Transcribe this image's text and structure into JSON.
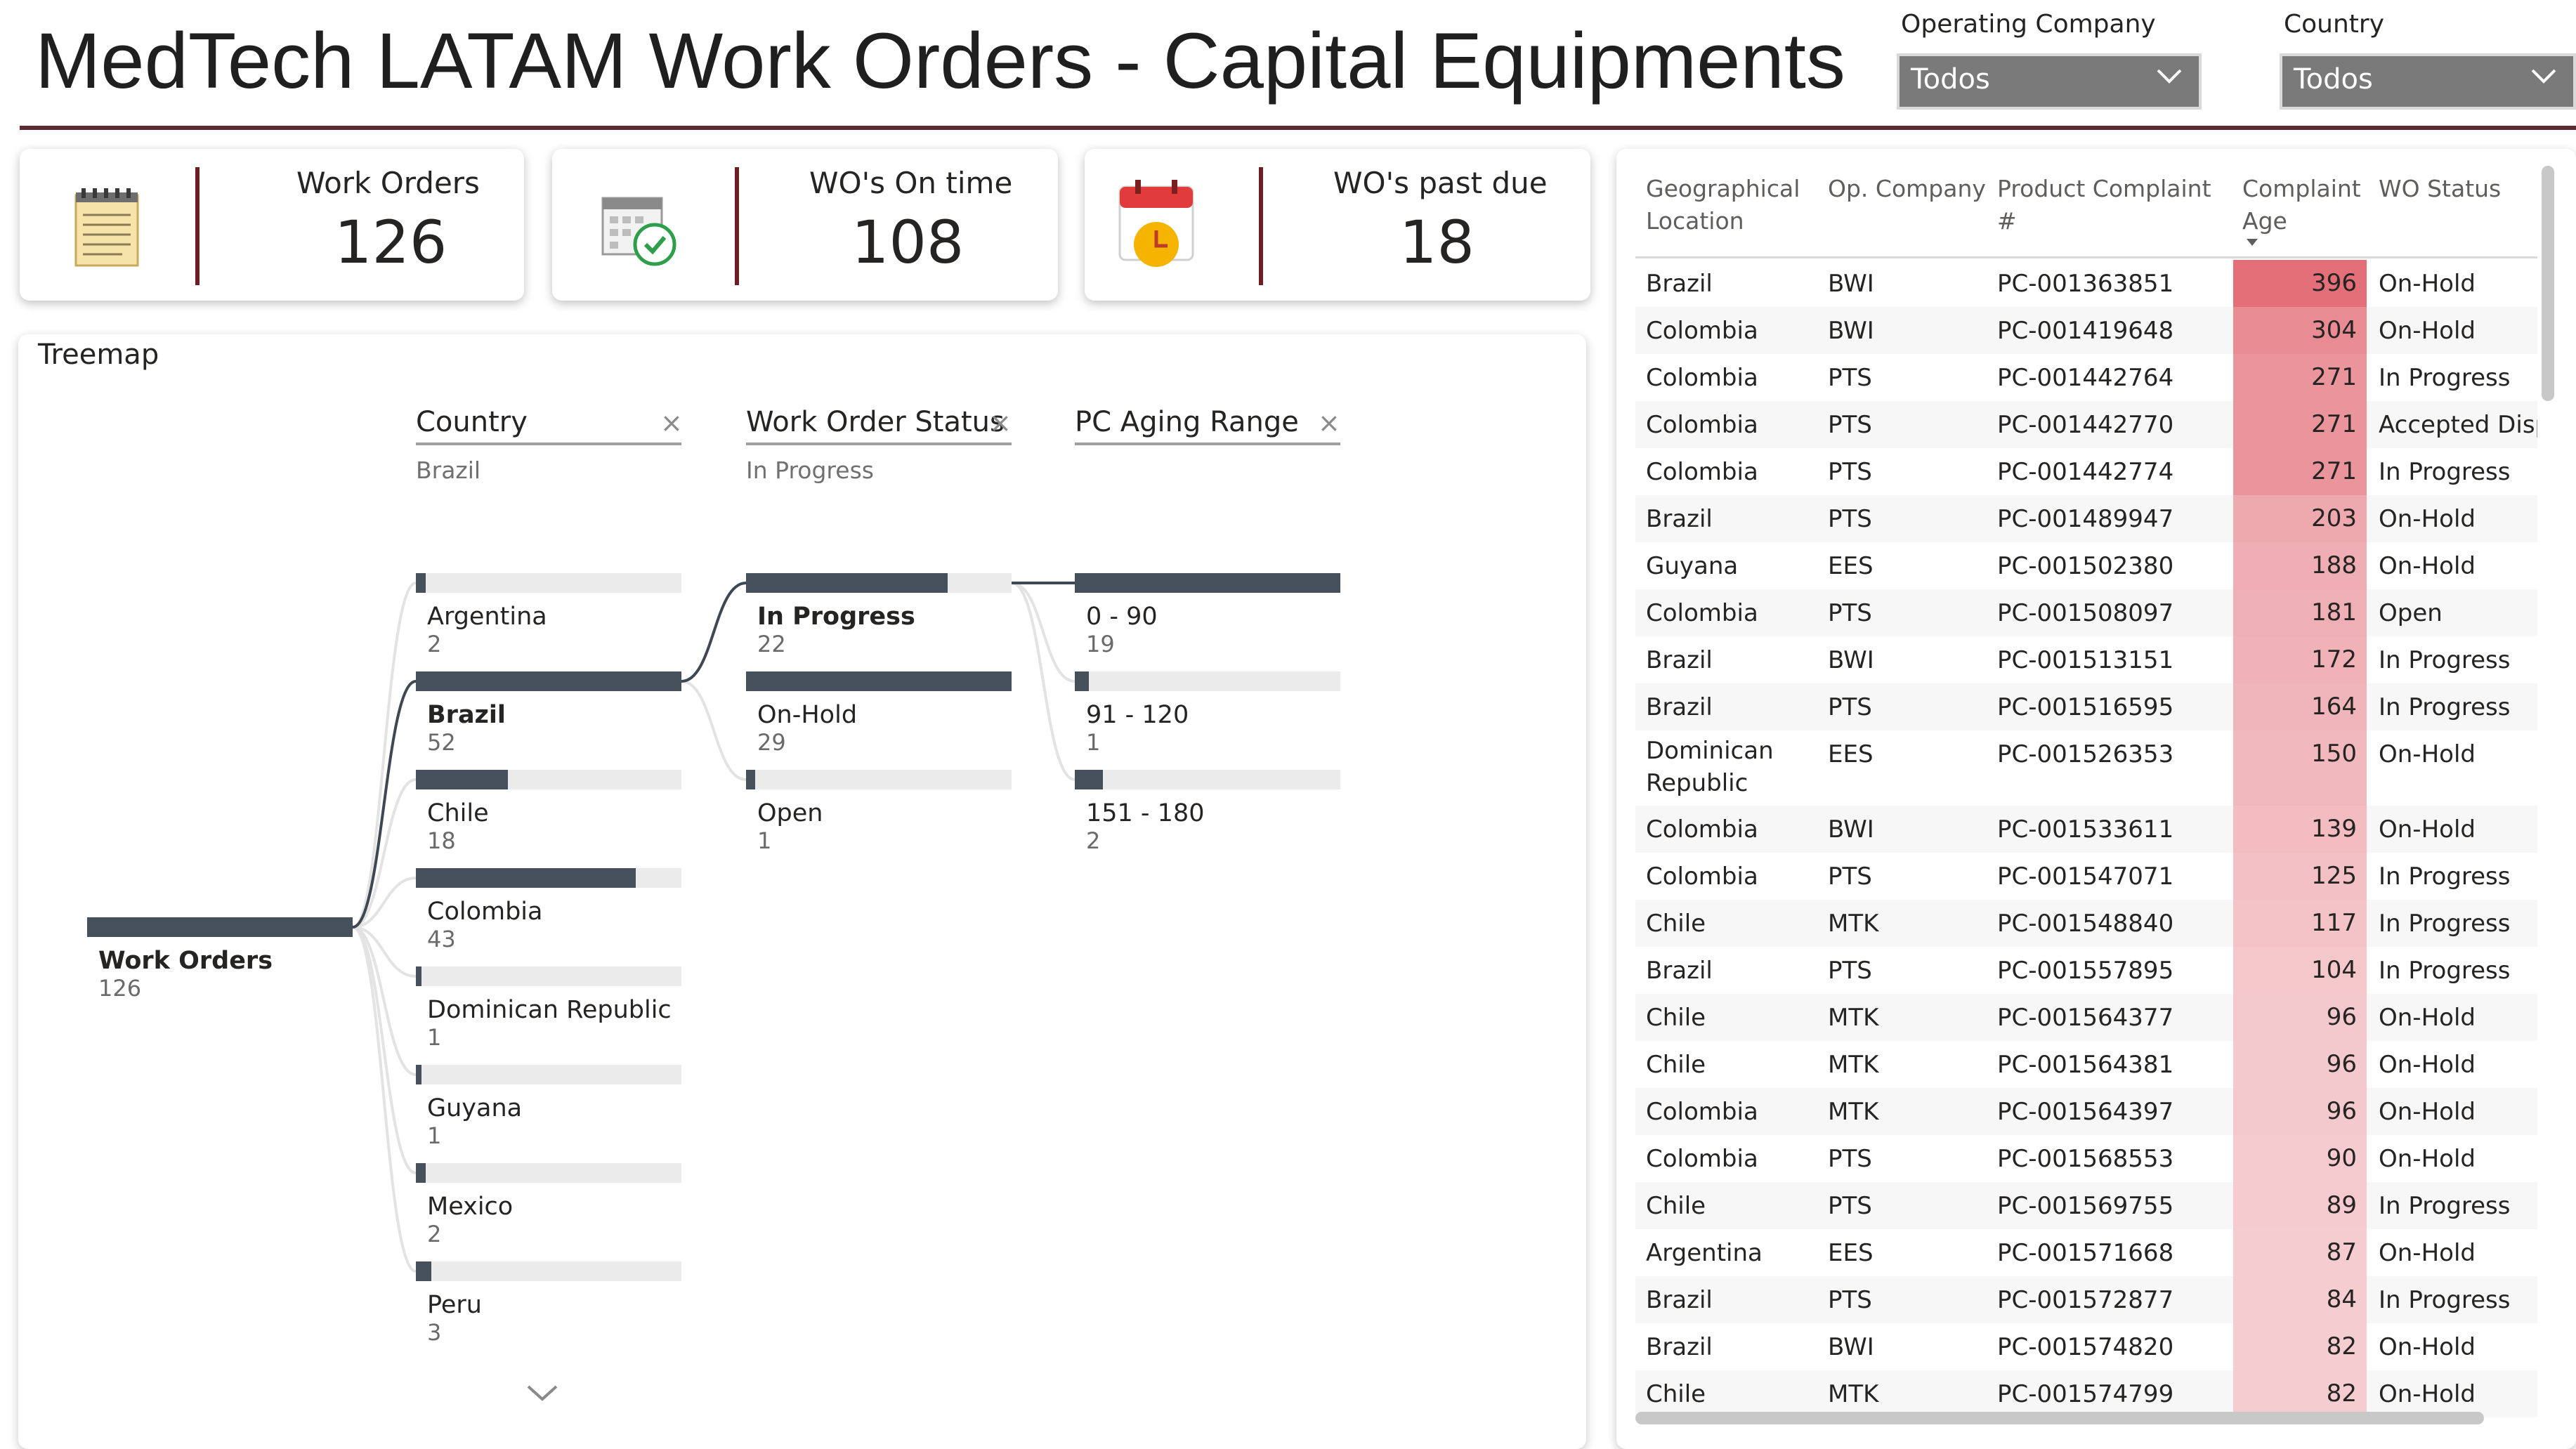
{
  "header": {
    "title": "MedTech LATAM Work Orders - Capital Equipments",
    "slicers": [
      {
        "label": "Operating Company",
        "value": "Todos"
      },
      {
        "label": "Country",
        "value": "Todos"
      }
    ]
  },
  "kpis": [
    {
      "label": "Work Orders",
      "value": "126",
      "icon": "notepad-icon"
    },
    {
      "label": "WO's On time",
      "value": "108",
      "icon": "calendar-check-icon"
    },
    {
      "label": "WO's past due",
      "value": "18",
      "icon": "calendar-clock-icon"
    }
  ],
  "tree": {
    "title": "Treemap",
    "root": {
      "label": "Work Orders",
      "value": "126",
      "fraction": 1.0
    },
    "levels": [
      {
        "header": "Country",
        "selected": "Brazil",
        "clear": "×"
      },
      {
        "header": "Work Order Status",
        "selected": "In Progress",
        "clear": "×"
      },
      {
        "header": "PC Aging Range",
        "selected": "",
        "clear": "×"
      }
    ],
    "countries": [
      {
        "label": "Argentina",
        "value": "2",
        "fraction": 0.038
      },
      {
        "label": "Brazil",
        "value": "52",
        "fraction": 1.0
      },
      {
        "label": "Chile",
        "value": "18",
        "fraction": 0.346
      },
      {
        "label": "Colombia",
        "value": "43",
        "fraction": 0.827
      },
      {
        "label": "Dominican Republic",
        "value": "1",
        "fraction": 0.019
      },
      {
        "label": "Guyana",
        "value": "1",
        "fraction": 0.019
      },
      {
        "label": "Mexico",
        "value": "2",
        "fraction": 0.038
      },
      {
        "label": "Peru",
        "value": "3",
        "fraction": 0.058
      }
    ],
    "statuses": [
      {
        "label": "In Progress",
        "value": "22",
        "fraction": 0.759
      },
      {
        "label": "On-Hold",
        "value": "29",
        "fraction": 1.0
      },
      {
        "label": "Open",
        "value": "1",
        "fraction": 0.034
      }
    ],
    "aging": [
      {
        "label": "0 - 90",
        "value": "19",
        "fraction": 1.0
      },
      {
        "label": "91 - 120",
        "value": "1",
        "fraction": 0.053
      },
      {
        "label": "151 - 180",
        "value": "2",
        "fraction": 0.105
      }
    ],
    "more_icon": "chevron-down-icon"
  },
  "table": {
    "columns": [
      "Geographical Location",
      "Op. Company",
      "Product Complaint #",
      "Complaint Age",
      "WO Status"
    ],
    "sort_icon": "sort-descending-icon",
    "age_max": 396,
    "age_color_strong": "#e36f78",
    "age_color_light": "#fae6e8",
    "rows": [
      [
        "Brazil",
        "BWI",
        "PC-001363851",
        "396",
        "On-Hold"
      ],
      [
        "Colombia",
        "BWI",
        "PC-001419648",
        "304",
        "On-Hold"
      ],
      [
        "Colombia",
        "PTS",
        "PC-001442764",
        "271",
        "In Progress"
      ],
      [
        "Colombia",
        "PTS",
        "PC-001442770",
        "271",
        "Accepted Disp"
      ],
      [
        "Colombia",
        "PTS",
        "PC-001442774",
        "271",
        "In Progress"
      ],
      [
        "Brazil",
        "PTS",
        "PC-001489947",
        "203",
        "On-Hold"
      ],
      [
        "Guyana",
        "EES",
        "PC-001502380",
        "188",
        "On-Hold"
      ],
      [
        "Colombia",
        "PTS",
        "PC-001508097",
        "181",
        "Open"
      ],
      [
        "Brazil",
        "BWI",
        "PC-001513151",
        "172",
        "In Progress"
      ],
      [
        "Brazil",
        "PTS",
        "PC-001516595",
        "164",
        "In Progress"
      ],
      [
        "Dominican Republic",
        "EES",
        "PC-001526353",
        "150",
        "On-Hold"
      ],
      [
        "Colombia",
        "BWI",
        "PC-001533611",
        "139",
        "On-Hold"
      ],
      [
        "Colombia",
        "PTS",
        "PC-001547071",
        "125",
        "In Progress"
      ],
      [
        "Chile",
        "MTK",
        "PC-001548840",
        "117",
        "In Progress"
      ],
      [
        "Brazil",
        "PTS",
        "PC-001557895",
        "104",
        "In Progress"
      ],
      [
        "Chile",
        "MTK",
        "PC-001564377",
        "96",
        "On-Hold"
      ],
      [
        "Chile",
        "MTK",
        "PC-001564381",
        "96",
        "On-Hold"
      ],
      [
        "Colombia",
        "MTK",
        "PC-001564397",
        "96",
        "On-Hold"
      ],
      [
        "Colombia",
        "PTS",
        "PC-001568553",
        "90",
        "On-Hold"
      ],
      [
        "Chile",
        "PTS",
        "PC-001569755",
        "89",
        "In Progress"
      ],
      [
        "Argentina",
        "EES",
        "PC-001571668",
        "87",
        "On-Hold"
      ],
      [
        "Brazil",
        "PTS",
        "PC-001572877",
        "84",
        "In Progress"
      ],
      [
        "Brazil",
        "BWI",
        "PC-001574820",
        "82",
        "On-Hold"
      ],
      [
        "Chile",
        "MTK",
        "PC-001574799",
        "82",
        "On-Hold"
      ]
    ]
  }
}
